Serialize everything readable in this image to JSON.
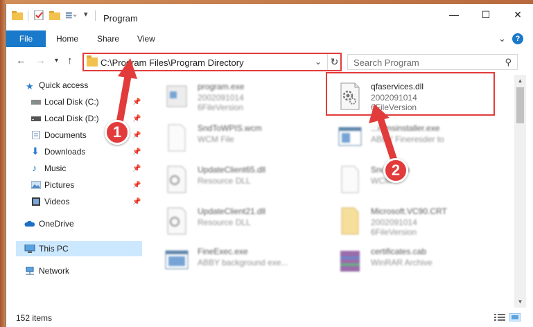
{
  "window": {
    "title": "Program"
  },
  "ribbon": {
    "tabs": [
      "File",
      "Home",
      "Share",
      "View"
    ]
  },
  "address": {
    "path": "C:\\Program Files\\Program Directory"
  },
  "search": {
    "placeholder": "Search Program"
  },
  "sidebar": {
    "items": [
      {
        "label": "Quick access",
        "icon": "star-icon",
        "pinned": false
      },
      {
        "label": "Local Disk (C:)",
        "icon": "drive-icon",
        "pinned": true
      },
      {
        "label": "Local Disk (D:)",
        "icon": "drive-icon",
        "pinned": true
      },
      {
        "label": "Documents",
        "icon": "documents-icon",
        "pinned": true
      },
      {
        "label": "Downloads",
        "icon": "downloads-icon",
        "pinned": true
      },
      {
        "label": "Music",
        "icon": "music-icon",
        "pinned": true
      },
      {
        "label": "Pictures",
        "icon": "pictures-icon",
        "pinned": true
      },
      {
        "label": "Videos",
        "icon": "videos-icon",
        "pinned": true
      },
      {
        "label": "OneDrive",
        "icon": "cloud-icon",
        "pinned": false
      },
      {
        "label": "This PC",
        "icon": "pc-icon",
        "pinned": false,
        "selected": true
      },
      {
        "label": "Network",
        "icon": "network-icon",
        "pinned": false
      }
    ]
  },
  "files": [
    {
      "name": "program.exe",
      "line2": "2002091014",
      "line3": "6FileVersion",
      "blurred": true,
      "icon": "exe-icon"
    },
    {
      "name": "qfaservices.dll",
      "line2": "2002091014",
      "line3": "6FileVersion",
      "blurred": false,
      "icon": "dll-icon",
      "highlighted": true
    },
    {
      "name": "SndToWPIS.wcm",
      "line2": "WCM File",
      "blurred": true,
      "icon": "file-icon"
    },
    {
      "name": "...mmsinstaller.exe",
      "line2": "ABBY Fineresder to",
      "blurred": true,
      "icon": "app-icon"
    },
    {
      "name": "UpdateClient65.dll",
      "line2": "Resource DLL",
      "blurred": true,
      "icon": "dll-icon"
    },
    {
      "name": "Snd...wcm",
      "line2": "WCM",
      "blurred": true,
      "icon": "file-icon"
    },
    {
      "name": "UpdateClient21.dll",
      "line2": "Resource DLL",
      "blurred": true,
      "icon": "dll-icon"
    },
    {
      "name": "Microsoft.VC90.CRT",
      "line2": "2002091014",
      "line3": "6FileVersion",
      "blurred": true,
      "icon": "folder-icon"
    },
    {
      "name": "FineExec.exe",
      "line2": "ABBY background exe...",
      "blurred": true,
      "icon": "app-icon"
    },
    {
      "name": "certificates.cab",
      "line2": "WinRAR Archive",
      "blurred": true,
      "icon": "archive-icon"
    }
  ],
  "status": {
    "count": "152 items"
  },
  "annotations": {
    "marker1": "1",
    "marker2": "2",
    "color": "#e23b3b"
  },
  "colors": {
    "accent": "#1979ca",
    "selection": "#cce8ff",
    "annotation": "#e23b3b"
  }
}
